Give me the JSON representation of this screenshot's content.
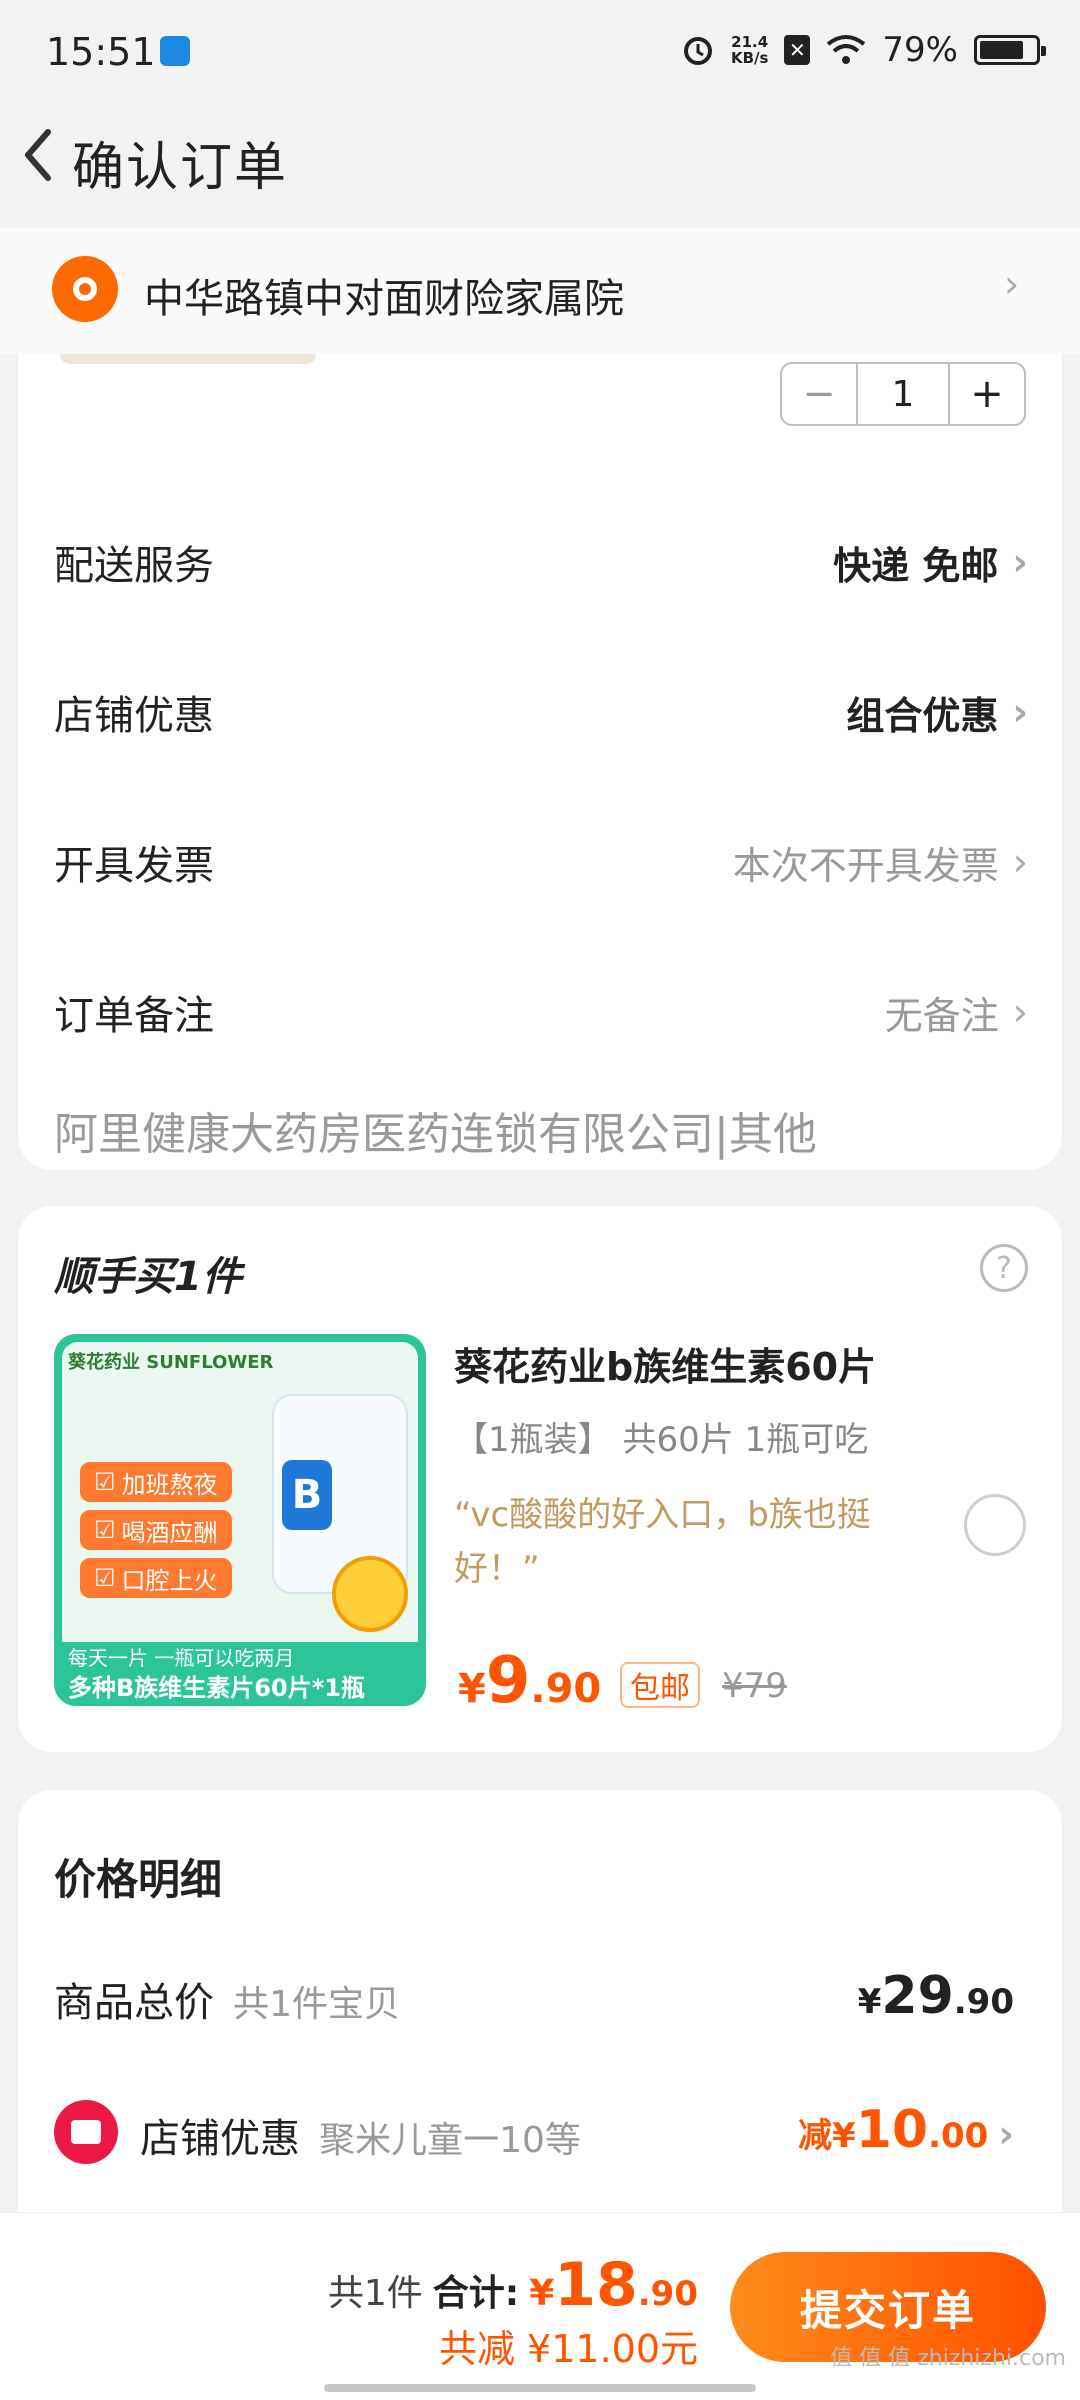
{
  "status_bar": {
    "time": "15:51",
    "speed_top": "21.4",
    "speed_bottom": "KB/s",
    "battery": "79%"
  },
  "header": {
    "title": "确认订单"
  },
  "address": {
    "text": "中华路镇中对面财险家属院"
  },
  "quantity": {
    "minus": "−",
    "value": "1",
    "plus": "+"
  },
  "order_rows": [
    {
      "label": "配送服务",
      "value": "快递 免邮"
    },
    {
      "label": "店铺优惠",
      "value": "组合优惠"
    },
    {
      "label": "开具发票",
      "value": "本次不开具发票"
    },
    {
      "label": "订单备注",
      "value": "无备注"
    }
  ],
  "shop_name": "阿里健康大药房医药连锁有限公司|其他",
  "add_on": {
    "title": "顺手买1件",
    "help": "?",
    "image": {
      "brand": "葵花药业 SUNFLOWER",
      "tags": [
        "加班熬夜",
        "喝酒应酬",
        "口腔上火"
      ],
      "bottle_letter": "B",
      "caption1": "每天一片  一瓶可以吃两月",
      "caption2": "多种B族维生素片60片*1瓶"
    },
    "name": "葵花药业b族维生素60片",
    "spec": "【1瓶装】 共60片 1瓶可吃",
    "quote": "“vc酸酸的好入口，b族也挺好！”",
    "price_currency": "¥",
    "price_int": "9",
    "price_dec": ".90",
    "badge": "包邮",
    "original_price": "¥79"
  },
  "price_detail": {
    "title": "价格明细",
    "total_label": "商品总价",
    "total_sub": "共1件宝贝",
    "total_cur": "¥",
    "total_int": "29",
    "total_dec": ".90",
    "discount_label": "店铺优惠",
    "discount_sub": "聚米儿童一10等",
    "discount_prefix": "减",
    "discount_cur": "¥",
    "discount_int": "10",
    "discount_dec": ".00"
  },
  "bottom_bar": {
    "count": "共1件",
    "sum_label": "合计:",
    "sum_cur": "¥",
    "sum_int": "18",
    "sum_dec": ".90",
    "saved": "共减 ¥11.00元",
    "submit": "提交订单"
  },
  "watermark": "值 值 值 zhizhizhi.com",
  "colors": {
    "accent": "#ff5500",
    "pin": "#ff6a00",
    "shop_icon": "#ee1846",
    "product_bg": "#2cc59a"
  },
  "icons": [
    "back-arrow-icon",
    "location-pin-icon",
    "chevron-right-icon",
    "help-circle-icon",
    "radio-unchecked-icon",
    "shop-coupon-icon",
    "alarm-icon",
    "wifi-icon",
    "battery-icon"
  ]
}
